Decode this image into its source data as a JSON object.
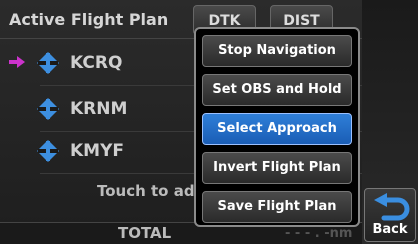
{
  "flight_plan": {
    "title": "Active Flight Plan",
    "columns": {
      "dtk": "DTK",
      "dist": "DIST"
    },
    "waypoints": [
      {
        "id": "KCRQ",
        "active": true
      },
      {
        "id": "KRNM",
        "active": false
      },
      {
        "id": "KMYF",
        "active": false
      }
    ],
    "touch_to_add": "Touch to ad",
    "total_label": "TOTAL",
    "total_value": "- - - . -nm"
  },
  "menu": {
    "items": [
      {
        "label": "Stop Navigation",
        "selected": false
      },
      {
        "label": "Set OBS and Hold",
        "selected": false
      },
      {
        "label": "Select Approach",
        "selected": true
      },
      {
        "label": "Invert Flight Plan",
        "selected": false
      },
      {
        "label": "Save Flight Plan",
        "selected": false
      }
    ]
  },
  "side": {
    "back_label": "Back",
    "back_icon": "back-arrow-icon"
  },
  "colors": {
    "accent": "#1f6cd0",
    "waypoint": "#3d8fe0",
    "active_arrow": "#cc33cc"
  }
}
